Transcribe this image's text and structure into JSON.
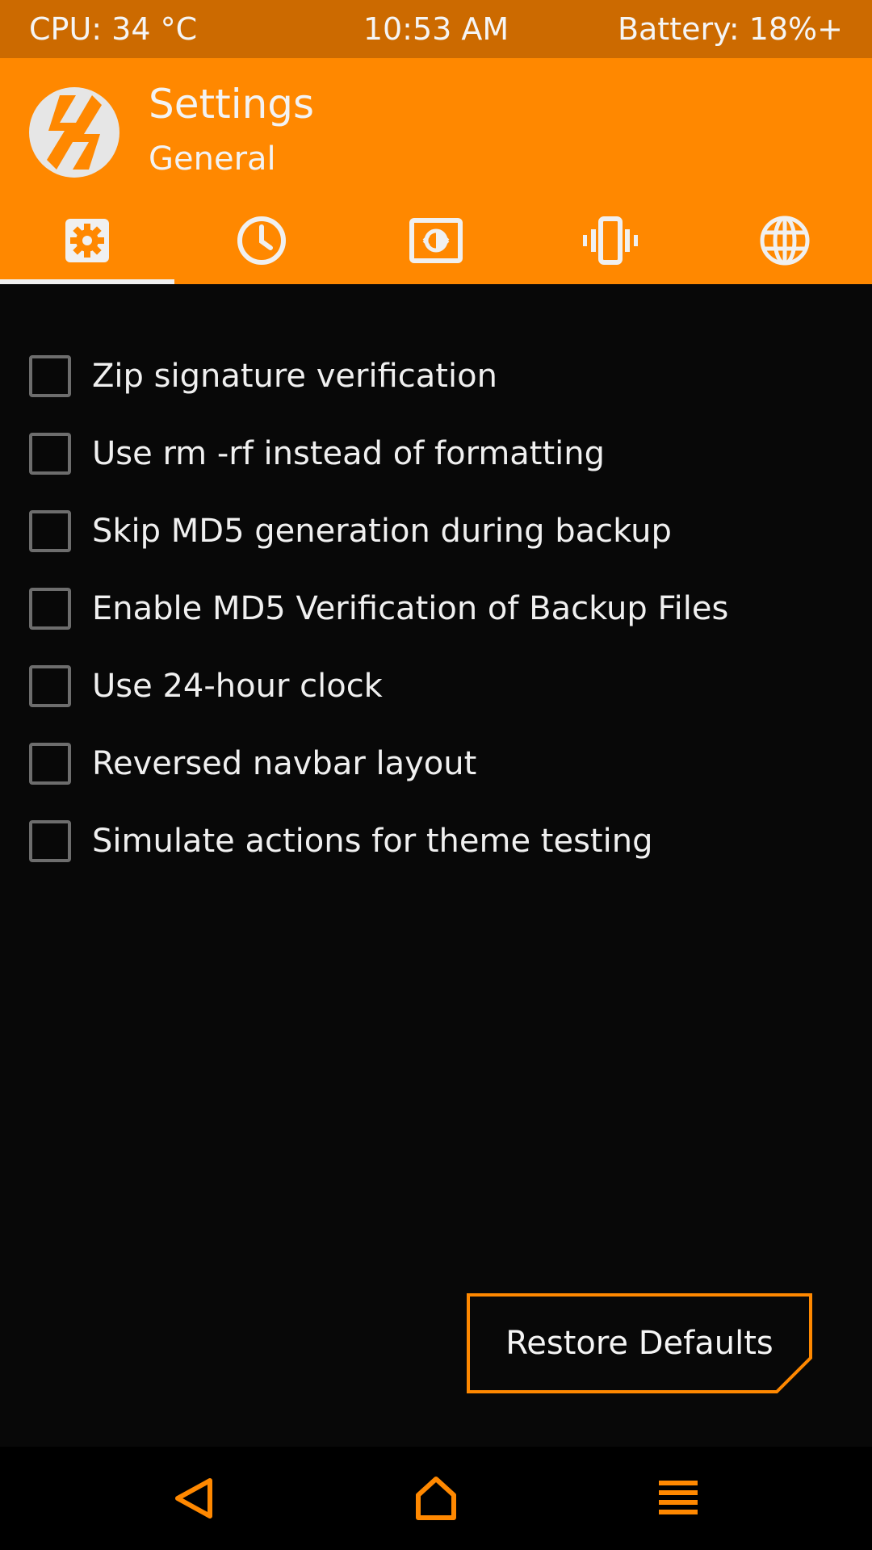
{
  "status_bar": {
    "cpu": "CPU: 34 °C",
    "time": "10:53 AM",
    "battery": "Battery: 18%+"
  },
  "header": {
    "title": "Settings",
    "subtitle": "General"
  },
  "tabs": [
    {
      "icon": "gear-icon",
      "active": true
    },
    {
      "icon": "clock-icon",
      "active": false
    },
    {
      "icon": "brightness-icon",
      "active": false
    },
    {
      "icon": "vibration-icon",
      "active": false
    },
    {
      "icon": "globe-icon",
      "active": false
    }
  ],
  "options": [
    {
      "label": "Zip signature verification",
      "checked": false
    },
    {
      "label": "Use rm -rf instead of formatting",
      "checked": false
    },
    {
      "label": "Skip MD5 generation during backup",
      "checked": false
    },
    {
      "label": "Enable MD5 Verification of Backup Files",
      "checked": false
    },
    {
      "label": "Use 24-hour clock",
      "checked": false
    },
    {
      "label": "Reversed navbar layout",
      "checked": false
    },
    {
      "label": "Simulate actions for theme testing",
      "checked": false
    }
  ],
  "restore_button": {
    "label": "Restore Defaults"
  },
  "navbar": {
    "back_icon": "back-triangle-icon",
    "home_icon": "home-icon",
    "menu_icon": "menu-icon"
  },
  "colors": {
    "accent": "#ff8800",
    "status_bar": "#cc6a00",
    "background": "#080808"
  }
}
